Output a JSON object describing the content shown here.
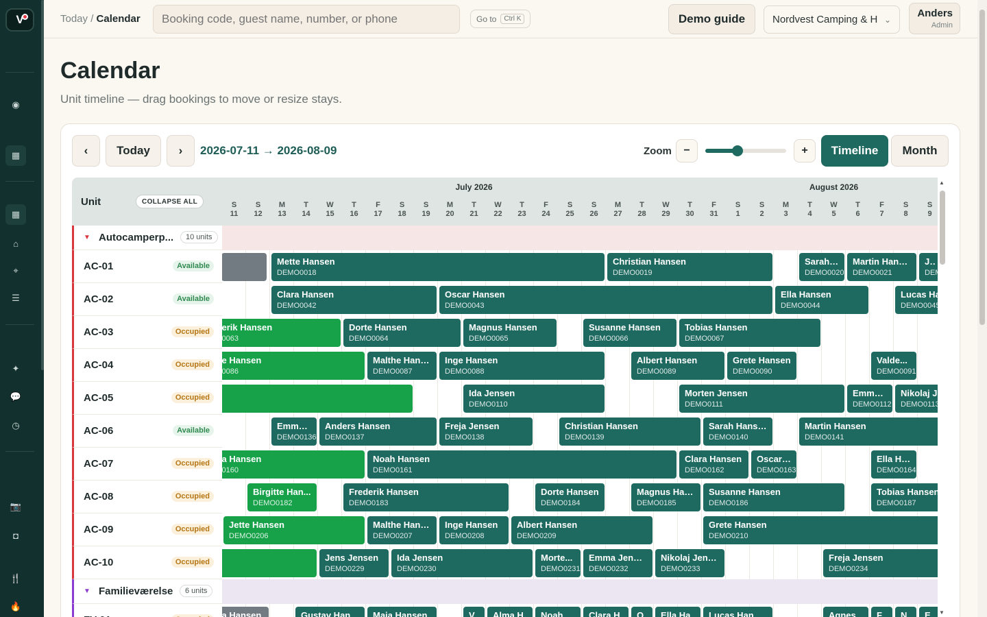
{
  "app": {
    "logo_text": "V"
  },
  "breadcrumb": {
    "root": "Today",
    "sep": "/",
    "current": "Calendar"
  },
  "search": {
    "placeholder": "Booking code, guest name, number, or phone"
  },
  "goto": {
    "label": "Go to",
    "shortcut": "Ctrl K"
  },
  "demo_guide": "Demo guide",
  "campsite": {
    "selected": "Nordvest Camping & H"
  },
  "user": {
    "name": "Anders",
    "role": "Admin"
  },
  "page": {
    "title": "Calendar",
    "subtitle": "Unit timeline — drag bookings to move or resize stays."
  },
  "toolbar": {
    "prev": "‹",
    "today": "Today",
    "next": "›",
    "range": "2026-07-11 → 2026-08-09",
    "zoom_label": "Zoom",
    "zoom_minus": "−",
    "zoom_plus": "+",
    "zoom_level": 0.4,
    "views": [
      "Timeline",
      "Month"
    ],
    "active_view": "Timeline"
  },
  "timeline": {
    "unit_header": "Unit",
    "collapse_all": "COLLAPSE ALL",
    "months": [
      {
        "label": "July 2026",
        "start": 0,
        "span": 21
      },
      {
        "label": "August 2026",
        "start": 21,
        "span": 9
      }
    ],
    "days": [
      {
        "w": "S",
        "d": "11"
      },
      {
        "w": "S",
        "d": "12"
      },
      {
        "w": "M",
        "d": "13"
      },
      {
        "w": "T",
        "d": "14"
      },
      {
        "w": "W",
        "d": "15"
      },
      {
        "w": "T",
        "d": "16"
      },
      {
        "w": "F",
        "d": "17"
      },
      {
        "w": "S",
        "d": "18"
      },
      {
        "w": "S",
        "d": "19"
      },
      {
        "w": "M",
        "d": "20"
      },
      {
        "w": "T",
        "d": "21"
      },
      {
        "w": "W",
        "d": "22"
      },
      {
        "w": "T",
        "d": "23"
      },
      {
        "w": "F",
        "d": "24"
      },
      {
        "w": "S",
        "d": "25"
      },
      {
        "w": "S",
        "d": "26"
      },
      {
        "w": "M",
        "d": "27"
      },
      {
        "w": "T",
        "d": "28"
      },
      {
        "w": "W",
        "d": "29"
      },
      {
        "w": "T",
        "d": "30"
      },
      {
        "w": "F",
        "d": "31"
      },
      {
        "w": "S",
        "d": "1"
      },
      {
        "w": "S",
        "d": "2"
      },
      {
        "w": "M",
        "d": "3"
      },
      {
        "w": "T",
        "d": "4"
      },
      {
        "w": "W",
        "d": "5"
      },
      {
        "w": "T",
        "d": "6"
      },
      {
        "w": "F",
        "d": "7"
      },
      {
        "w": "S",
        "d": "8"
      },
      {
        "w": "S",
        "d": "9"
      }
    ],
    "groups": [
      {
        "name": "Autocamperp...",
        "count": "10 units",
        "color": "#d9363e",
        "units": [
          {
            "name": "AC-01",
            "status": "Available",
            "bookings": [
              {
                "g": "",
                "c": "",
                "s": -0.1,
                "e": 1.9,
                "k": "grey"
              },
              {
                "g": "Mette Hansen",
                "c": "DEMO0018",
                "s": 2,
                "e": 16
              },
              {
                "g": "Christian Hansen",
                "c": "DEMO0019",
                "s": 16,
                "e": 23
              },
              {
                "g": "Sarah ...",
                "c": "DEMO0020",
                "s": 24,
                "e": 26
              },
              {
                "g": "Martin Hansen",
                "c": "DEMO0021",
                "s": 26,
                "e": 29
              },
              {
                "g": "Jul",
                "c": "DEM",
                "s": 29,
                "e": 30
              }
            ]
          },
          {
            "name": "AC-02",
            "status": "Available",
            "bookings": [
              {
                "g": "Clara Hansen",
                "c": "DEMO0042",
                "s": 2,
                "e": 9
              },
              {
                "g": "Oscar Hansen",
                "c": "DEMO0043",
                "s": 9,
                "e": 23
              },
              {
                "g": "Ella Hansen",
                "c": "DEMO0044",
                "s": 23,
                "e": 27
              },
              {
                "g": "Lucas Ha",
                "c": "DEMO0045",
                "s": 28,
                "e": 30.5
              }
            ]
          },
          {
            "name": "AC-03",
            "status": "Occupied",
            "bookings": [
              {
                "g": "erik Hansen",
                "c": "0063",
                "s": -0.5,
                "e": 5,
                "k": "green"
              },
              {
                "g": "Dorte Hansen",
                "c": "DEMO0064",
                "s": 5,
                "e": 10
              },
              {
                "g": "Magnus Hansen",
                "c": "DEMO0065",
                "s": 10,
                "e": 14
              },
              {
                "g": "Susanne Hansen",
                "c": "DEMO0066",
                "s": 15,
                "e": 19
              },
              {
                "g": "Tobias Hansen",
                "c": "DEMO0067",
                "s": 19,
                "e": 25
              }
            ]
          },
          {
            "name": "AC-04",
            "status": "Occupied",
            "bookings": [
              {
                "g": "e Hansen",
                "c": "0086",
                "s": -0.5,
                "e": 6,
                "k": "green"
              },
              {
                "g": "Malthe Hans...",
                "c": "DEMO0087",
                "s": 6,
                "e": 9
              },
              {
                "g": "Inge Hansen",
                "c": "DEMO0088",
                "s": 9,
                "e": 16
              },
              {
                "g": "Albert Hansen",
                "c": "DEMO0089",
                "s": 17,
                "e": 21
              },
              {
                "g": "Grete Hansen",
                "c": "DEMO0090",
                "s": 21,
                "e": 24
              },
              {
                "g": "Valde...",
                "c": "DEMO0091",
                "s": 27,
                "e": 29
              }
            ]
          },
          {
            "name": "AC-05",
            "status": "Occupied",
            "bookings": [
              {
                "g": "",
                "c": "",
                "s": -0.5,
                "e": 8,
                "k": "green"
              },
              {
                "g": "Ida Jensen",
                "c": "DEMO0110",
                "s": 10,
                "e": 16
              },
              {
                "g": "Morten Jensen",
                "c": "DEMO0111",
                "s": 19,
                "e": 26
              },
              {
                "g": "Emma ...",
                "c": "DEMO0112",
                "s": 26,
                "e": 28
              },
              {
                "g": "Nikolaj Je",
                "c": "DEMO0113",
                "s": 28,
                "e": 30.5
              }
            ]
          },
          {
            "name": "AC-06",
            "status": "Available",
            "bookings": [
              {
                "g": "Emma ...",
                "c": "DEMO0136",
                "s": 2,
                "e": 4
              },
              {
                "g": "Anders Hansen",
                "c": "DEMO0137",
                "s": 4,
                "e": 9
              },
              {
                "g": "Freja Jensen",
                "c": "DEMO0138",
                "s": 9,
                "e": 13
              },
              {
                "g": "Christian Hansen",
                "c": "DEMO0139",
                "s": 14,
                "e": 20
              },
              {
                "g": "Sarah Hansen",
                "c": "DEMO0140",
                "s": 20,
                "e": 23
              },
              {
                "g": "Martin Hansen",
                "c": "DEMO0141",
                "s": 24,
                "e": 30.5
              }
            ]
          },
          {
            "name": "AC-07",
            "status": "Occupied",
            "bookings": [
              {
                "g": "a Hansen",
                "c": "0160",
                "s": -0.5,
                "e": 6,
                "k": "green"
              },
              {
                "g": "Noah Hansen",
                "c": "DEMO0161",
                "s": 6,
                "e": 19
              },
              {
                "g": "Clara Hansen",
                "c": "DEMO0162",
                "s": 19,
                "e": 22
              },
              {
                "g": "Oscar ...",
                "c": "DEMO0163",
                "s": 22,
                "e": 24
              },
              {
                "g": "Ella Ha...",
                "c": "DEMO0164",
                "s": 27,
                "e": 29
              }
            ]
          },
          {
            "name": "AC-08",
            "status": "Occupied",
            "bookings": [
              {
                "g": "Birgitte Han...",
                "c": "DEMO0182",
                "s": 1,
                "e": 4,
                "k": "green"
              },
              {
                "g": "Frederik Hansen",
                "c": "DEMO0183",
                "s": 5,
                "e": 12
              },
              {
                "g": "Dorte Hansen",
                "c": "DEMO0184",
                "s": 13,
                "e": 16
              },
              {
                "g": "Magnus Han...",
                "c": "DEMO0185",
                "s": 17,
                "e": 20
              },
              {
                "g": "Susanne Hansen",
                "c": "DEMO0186",
                "s": 20,
                "e": 26
              },
              {
                "g": "Tobias Hansen",
                "c": "DEMO0187",
                "s": 27,
                "e": 30.5
              }
            ]
          },
          {
            "name": "AC-09",
            "status": "Occupied",
            "bookings": [
              {
                "g": "Jette Hansen",
                "c": "DEMO0206",
                "s": 0,
                "e": 6,
                "k": "green"
              },
              {
                "g": "Malthe Hans...",
                "c": "DEMO0207",
                "s": 6,
                "e": 9
              },
              {
                "g": "Inge Hansen",
                "c": "DEMO0208",
                "s": 9,
                "e": 12
              },
              {
                "g": "Albert Hansen",
                "c": "DEMO0209",
                "s": 12,
                "e": 18
              },
              {
                "g": "Grete Hansen",
                "c": "DEMO0210",
                "s": 20,
                "e": 30.5
              }
            ]
          },
          {
            "name": "AC-10",
            "status": "Occupied",
            "bookings": [
              {
                "g": "",
                "c": "",
                "s": -0.5,
                "e": 4,
                "k": "green"
              },
              {
                "g": "Jens Jensen",
                "c": "DEMO0229",
                "s": 4,
                "e": 7
              },
              {
                "g": "Ida Jensen",
                "c": "DEMO0230",
                "s": 7,
                "e": 13
              },
              {
                "g": "Morte...",
                "c": "DEMO0231",
                "s": 13,
                "e": 15
              },
              {
                "g": "Emma Jensen",
                "c": "DEMO0232",
                "s": 15,
                "e": 18
              },
              {
                "g": "Nikolaj Jensen",
                "c": "DEMO0233",
                "s": 18,
                "e": 21
              },
              {
                "g": "Freja Jensen",
                "c": "DEMO0234",
                "s": 25,
                "e": 30.5
              }
            ]
          }
        ]
      },
      {
        "name": "Familieværelse",
        "count": "6 units",
        "color": "#8a3bd1",
        "units": [
          {
            "name": "FV-01",
            "status": "Occupied",
            "bookings": [
              {
                "g": "a Hansen",
                "c": "",
                "s": -0.5,
                "e": 2,
                "k": "grey"
              },
              {
                "g": "Gustav Han",
                "c": "",
                "s": 3,
                "e": 6
              },
              {
                "g": "Maja Hansen",
                "c": "",
                "s": 6,
                "e": 9
              },
              {
                "g": "Vic",
                "c": "",
                "s": 10,
                "e": 11
              },
              {
                "g": "Alma H",
                "c": "",
                "s": 11,
                "e": 13
              },
              {
                "g": "Noah",
                "c": "",
                "s": 13,
                "e": 15
              },
              {
                "g": "Clara H",
                "c": "",
                "s": 15,
                "e": 17
              },
              {
                "g": "Osc",
                "c": "",
                "s": 17,
                "e": 18
              },
              {
                "g": "Ella Ha",
                "c": "",
                "s": 18,
                "e": 20
              },
              {
                "g": "Lucas Hansen",
                "c": "",
                "s": 20,
                "e": 23
              },
              {
                "g": "Agnes",
                "c": "",
                "s": 25,
                "e": 27
              },
              {
                "g": "Fel",
                "c": "",
                "s": 27,
                "e": 28
              },
              {
                "g": "Nor",
                "c": "",
                "s": 28,
                "e": 29
              },
              {
                "g": "Ell",
                "c": "",
                "s": 29,
                "e": 30
              }
            ]
          }
        ]
      }
    ]
  }
}
